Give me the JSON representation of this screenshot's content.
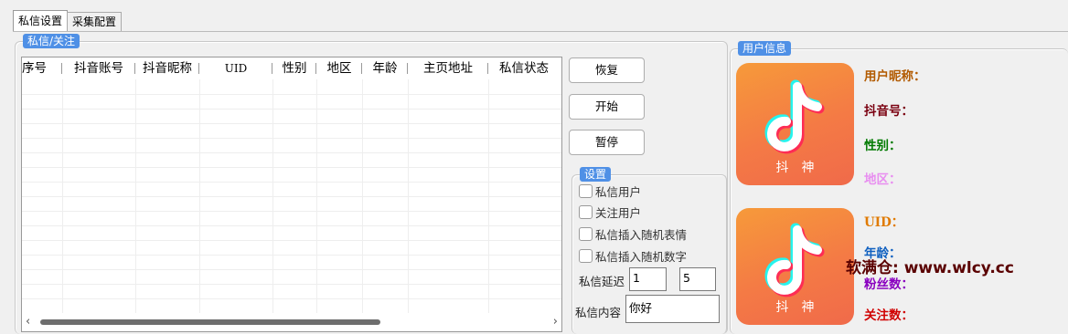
{
  "tabs": [
    {
      "label": "私信设置",
      "active": true
    },
    {
      "label": "采集配置",
      "active": false
    }
  ],
  "message_group": {
    "title": "私信/关注",
    "columns": [
      "序号",
      "抖音账号",
      "抖音昵称",
      "UID",
      "性别",
      "地区",
      "年龄",
      "主页地址",
      "私信状态"
    ],
    "rows": []
  },
  "actions": {
    "restore": "恢复",
    "start": "开始",
    "pause": "暂停"
  },
  "settings": {
    "title": "设置",
    "options": [
      {
        "label": "私信用户",
        "checked": false
      },
      {
        "label": "关注用户",
        "checked": false
      },
      {
        "label": "私信插入随机表情",
        "checked": false
      },
      {
        "label": "私信插入随机数字",
        "checked": false
      }
    ],
    "delay_label": "私信延迟",
    "delay_min": "1",
    "delay_max": "5",
    "content_label": "私信内容",
    "content_value": "你好"
  },
  "user_info": {
    "title": "用户信息",
    "avatar_text": "抖神",
    "fields": [
      {
        "label": "用户昵称：",
        "color": "#b25a00"
      },
      {
        "label": "抖音号：",
        "color": "#7a0010"
      },
      {
        "label": "性别：",
        "color": "#007a00"
      },
      {
        "label": "地区：",
        "color": "#e88ef0"
      },
      {
        "label": "UID：",
        "color": "#e07a00"
      },
      {
        "label": "年龄：",
        "color": "#1060c0"
      },
      {
        "label": "粉丝数：",
        "color": "#8a00c0"
      },
      {
        "label": "关注数：",
        "color": "#d00000"
      }
    ]
  },
  "watermark": "软满仓: www.wlcy.cc",
  "colors": {
    "group_title_bg": "#4f90e6",
    "avatar_orange": "#f47a45"
  }
}
